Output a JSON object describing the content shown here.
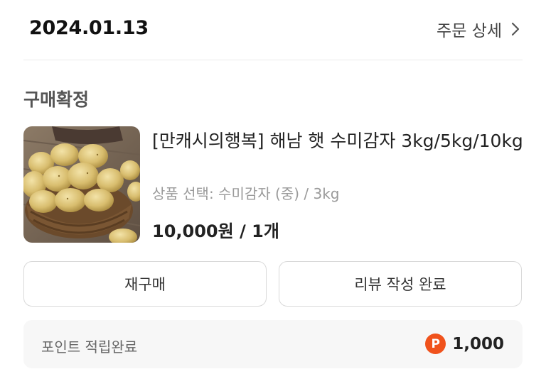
{
  "order": {
    "date": "2024.01.13",
    "detail_link": "주문 상세",
    "status": "구매확정"
  },
  "product": {
    "image_icon": "potato-basket-photo",
    "name": "[만캐시의행복] 해남 햇 수미감자 3kg/5kg/10kg",
    "option": "상품 선택: 수미감자 (중) / 3kg",
    "price_qty": "10,000원 / 1개"
  },
  "actions": {
    "rebuy_label": "재구매",
    "review_label": "리뷰 작성 완료"
  },
  "points": {
    "label": "포인트 적립완료",
    "badge": "P",
    "amount": "1,000",
    "badge_color": "#f0521c"
  }
}
